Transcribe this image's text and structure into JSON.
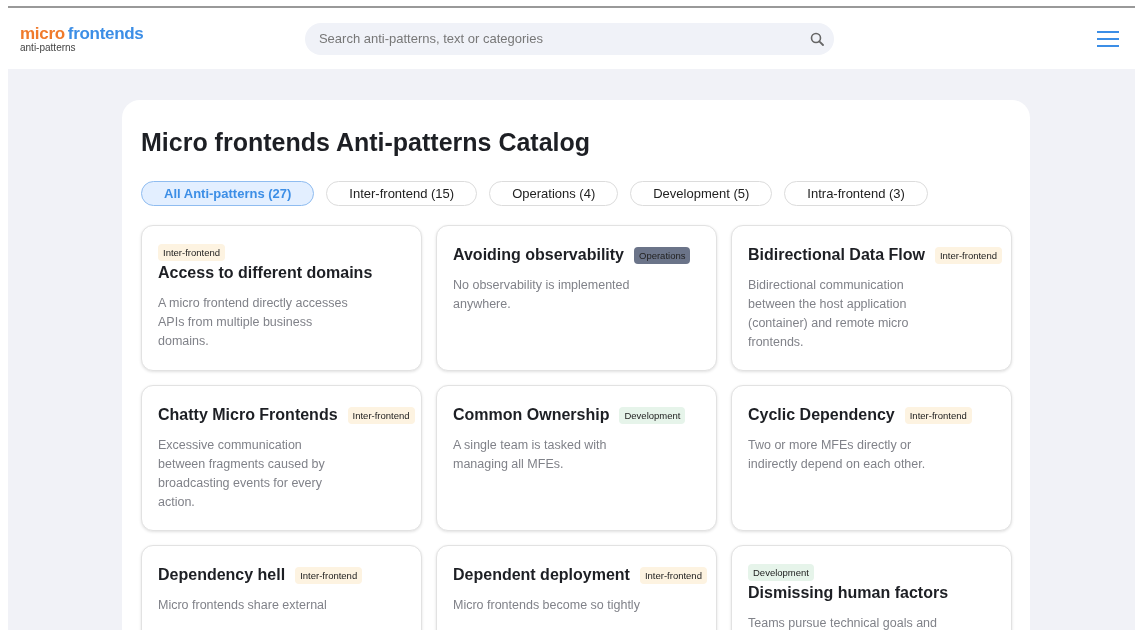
{
  "logo": {
    "word_1": "micro",
    "word_2": "frontends",
    "subtitle": "anti-patterns"
  },
  "search": {
    "placeholder": "Search anti-patterns, text or categories"
  },
  "catalog": {
    "title": "Micro frontends Anti-patterns Catalog",
    "filters": [
      {
        "label": "All Anti-patterns (27)",
        "selected": true
      },
      {
        "label": "Inter-frontend (15)",
        "selected": false
      },
      {
        "label": "Operations (4)",
        "selected": false
      },
      {
        "label": "Development (5)",
        "selected": false
      },
      {
        "label": "Intra-frontend (3)",
        "selected": false
      }
    ],
    "cards": [
      {
        "kind": "tag-above",
        "title": "Access to different domains",
        "tag": "Inter-frontend",
        "color": "#fdf3e1",
        "description": "A micro frontend directly accesses APIs from multiple business domains."
      },
      {
        "kind": "tag-inline",
        "title": "Avoiding observability",
        "tag": "Operations",
        "color": "#6b7489",
        "description": "No observability is implemented anywhere."
      },
      {
        "kind": "tag-inline",
        "title": "Bidirectional Data Flow",
        "tag": "Inter-frontend",
        "color": "#fdf3e1",
        "description": "Bidirectional communication between the host application (container) and remote micro frontends."
      },
      {
        "kind": "tag-inline",
        "title": "Chatty Micro Frontends",
        "tag": "Inter-frontend",
        "color": "#fdf3e1",
        "description": "Excessive communication between fragments caused by broadcasting events for every action."
      },
      {
        "kind": "tag-inline",
        "title": "Common Ownership",
        "tag": "Development",
        "color": "#e6f4ea",
        "description": "A single team is tasked with managing all MFEs."
      },
      {
        "kind": "tag-inline",
        "title": "Cyclic Dependency",
        "tag": "Inter-frontend",
        "color": "#fdf3e1",
        "description": "Two or more MFEs directly or indirectly depend on each other."
      },
      {
        "kind": "tag-inline",
        "title": "Dependency hell",
        "tag": "Inter-frontend",
        "color": "#fdf3e1",
        "description": "Micro frontends share external"
      },
      {
        "kind": "tag-inline",
        "title": "Dependent deployment",
        "tag": "Inter-frontend",
        "color": "#fdf3e1",
        "description": "Micro frontends become so tightly"
      },
      {
        "kind": "tag-above",
        "title": "Dismissing human factors",
        "tag": "Development",
        "color": "#e6f4ea",
        "description": "Teams pursue technical goals and"
      }
    ]
  }
}
